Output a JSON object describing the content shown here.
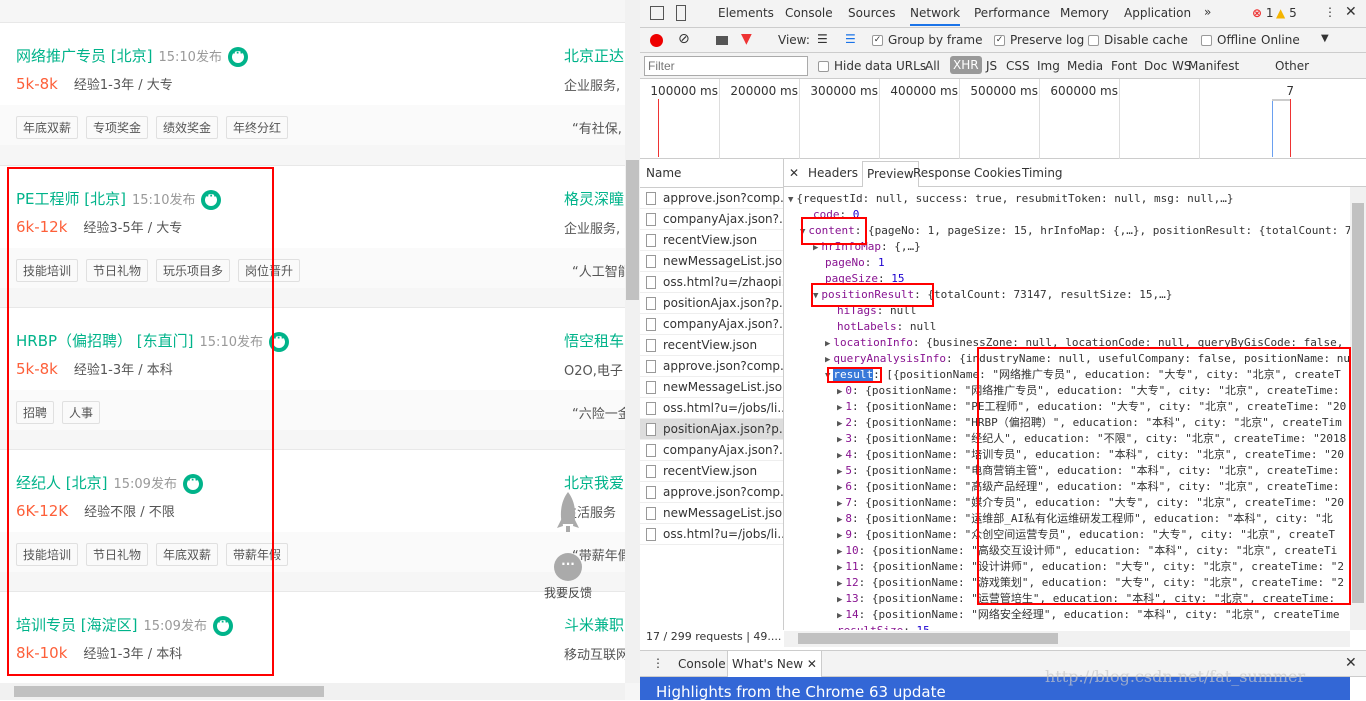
{
  "page": {
    "jobs": [
      {
        "title": "网络推广专员 [北京]",
        "time": "15:10发布",
        "salary": "5k-8k",
        "req": "经验1-3年 / 大专",
        "company": "北京正达",
        "industry": "企业服务,",
        "tags": [
          "年底双薪",
          "专项奖金",
          "绩效奖金",
          "年终分红"
        ],
        "quote": "“有社保,"
      },
      {
        "title": "PE工程师 [北京]",
        "time": "15:10发布",
        "salary": "6k-12k",
        "req": "经验3-5年 / 大专",
        "company": "格灵深瞳",
        "industry": "企业服务,",
        "tags": [
          "技能培训",
          "节日礼物",
          "玩乐项目多",
          "岗位晋升"
        ],
        "quote": "“人工智能"
      },
      {
        "title": "HRBP（偏招聘） [东直门]",
        "time": "15:10发布",
        "salary": "5k-8k",
        "req": "经验1-3年 / 本科",
        "company": "悟空租车",
        "industry": "O2O,电子",
        "tags": [
          "招聘",
          "人事"
        ],
        "quote": "“六险一金"
      },
      {
        "title": "经纪人 [北京]",
        "time": "15:09发布",
        "salary": "6K-12K",
        "req": "经验不限 / 不限",
        "company": "北京我爱",
        "industry": "生活服务",
        "tags": [
          "技能培训",
          "节日礼物",
          "年底双薪",
          "带薪年假"
        ],
        "quote": "“带薪年假"
      },
      {
        "title": "培训专员 [海淀区]",
        "time": "15:09发布",
        "salary": "8k-10k",
        "req": "经验1-3年 / 本科",
        "company": "斗米兼职",
        "industry": "移动互联网",
        "tags": [],
        "quote": ""
      }
    ],
    "feedback_label": "我要反馈"
  },
  "devtools": {
    "tabs": [
      "Elements",
      "Console",
      "Sources",
      "Network",
      "Performance",
      "Memory",
      "Application"
    ],
    "active_tab": "Network",
    "errors": "1",
    "warnings": "5",
    "toolbar": {
      "view": "View:",
      "group_by_frame": "Group by frame",
      "preserve_log": "Preserve log",
      "disable_cache": "Disable cache",
      "offline": "Offline",
      "throttle": "Online"
    },
    "filter": {
      "placeholder": "Filter",
      "hide_data_urls": "Hide data URLs",
      "types": [
        "All",
        "XHR",
        "JS",
        "CSS",
        "Img",
        "Media",
        "Font",
        "Doc",
        "WS",
        "Manifest",
        "Other"
      ],
      "active": "XHR"
    },
    "timeline": [
      "100000 ms",
      "200000 ms",
      "300000 ms",
      "400000 ms",
      "500000 ms",
      "600000 ms",
      "7"
    ],
    "name_header": "Name",
    "requests": [
      "approve.json?comp...",
      "companyAjax.json?...",
      "recentView.json",
      "newMessageList.json",
      "oss.html?u=/zhaopi...",
      "positionAjax.json?p...",
      "companyAjax.json?...",
      "recentView.json",
      "approve.json?comp...",
      "newMessageList.json",
      "oss.html?u=/jobs/li...",
      "positionAjax.json?p...",
      "companyAjax.json?...",
      "recentView.json",
      "approve.json?comp...",
      "newMessageList.json",
      "oss.html?u=/jobs/li..."
    ],
    "selected_request": 11,
    "status": "17 / 299 requests | 49....",
    "detail_tabs": [
      "Headers",
      "Preview",
      "Response",
      "Cookies",
      "Timing"
    ],
    "active_detail_tab": "Preview",
    "preview": {
      "root": "{requestId: null, success: true, resubmitToken: null, msg: null,…}",
      "code": [
        "code",
        ": ",
        "0"
      ],
      "content": [
        "content",
        ": {pageNo: 1, pageSize: 15, hrInfoMap: {,…}, positionResult: {totalCount: 7"
      ],
      "hrInfoMap": [
        "hrInfoMap",
        ": {,…}"
      ],
      "pageNo": [
        "pageNo",
        ": ",
        "1"
      ],
      "pageSize": [
        "pageSize",
        ": ",
        "15"
      ],
      "positionResult": [
        "positionResult",
        ": {totalCount: 73147, resultSize: 15,…}"
      ],
      "hiTags": [
        "hiTags",
        ": null"
      ],
      "hotLabels": [
        "hotLabels",
        ": null"
      ],
      "locationInfo": [
        "locationInfo",
        ": {businessZone: null, locationCode: null, queryByGisCode: false,"
      ],
      "queryAnalysisInfo": [
        "queryAnalysisInfo",
        ": {industryName: null, usefulCompany: false, positionName: nu"
      ],
      "result": [
        "result",
        ": [{positionName: \"网络推广专员\", education: \"大专\", city: \"北京\", createT"
      ],
      "items": [
        ": {positionName: \"网络推广专员\", education: \"大专\", city: \"北京\", createTime:",
        ": {positionName: \"PE工程师\", education: \"大专\", city: \"北京\", createTime: \"20",
        ": {positionName: \"HRBP（偏招聘）\", education: \"本科\", city: \"北京\", createTim",
        ": {positionName: \"经纪人\", education: \"不限\", city: \"北京\", createTime: \"2018",
        ": {positionName: \"培训专员\", education: \"本科\", city: \"北京\", createTime: \"20",
        ": {positionName: \"电商营销主管\", education: \"本科\", city: \"北京\", createTime:",
        ": {positionName: \"高级产品经理\", education: \"本科\", city: \"北京\", createTime:",
        ": {positionName: \"媒介专员\", education: \"大专\", city: \"北京\", createTime: \"20",
        ": {positionName: \"运维部_AI私有化运维研发工程师\", education: \"本科\", city: \"北",
        ": {positionName: \"众创空间运营专员\", education: \"大专\", city: \"北京\", createT",
        ": {positionName: \"高级交互设计师\", education: \"本科\", city: \"北京\", createTi",
        ": {positionName: \"设计讲师\", education: \"大专\", city: \"北京\", createTime: \"2",
        ": {positionName: \"游戏策划\", education: \"大专\", city: \"北京\", createTime: \"2",
        ": {positionName: \"运营管培生\", education: \"本科\", city: \"北京\", createTime:",
        ": {positionName: \"网络安全经理\", education: \"本科\", city: \"北京\", createTime"
      ],
      "resultSize": [
        "resultSize",
        ": ",
        "15"
      ]
    },
    "drawer": {
      "tabs": [
        "Console",
        "What's New"
      ],
      "active": "What's New",
      "banner": "Highlights from the Chrome 63 update"
    },
    "watermark": "http://blog.csdn.net/fat_summer"
  },
  "colors": {
    "brand_green": "#00b38a",
    "salary": "#fd5f39",
    "highlight_red": "#ff0000",
    "banner_blue": "#3367d6"
  }
}
